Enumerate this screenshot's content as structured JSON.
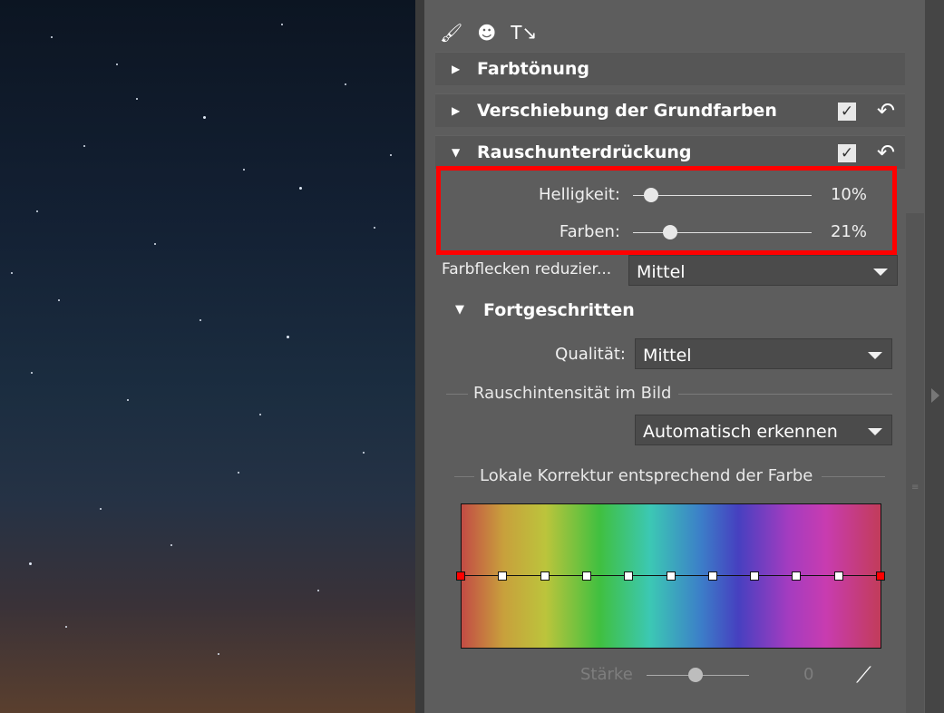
{
  "toolbar": {
    "icons": [
      "brush-icon",
      "mask-icon",
      "text-icon"
    ],
    "glyphs": {
      "brush": "🖌",
      "mask": "☻",
      "text": "T↘"
    }
  },
  "sections": {
    "farbtoenung": {
      "label": "Farbtönung",
      "expanded": false
    },
    "verschiebung": {
      "label": "Verschiebung der Grundfarben",
      "expanded": false,
      "checked": true
    },
    "rausch": {
      "label": "Rauschunterdrückung",
      "expanded": true,
      "checked": true
    }
  },
  "glyphs": {
    "collapsed": "▶",
    "expanded": "▼",
    "check": "✓",
    "undo": "↶",
    "picker": "⟋",
    "grip": "≡"
  },
  "noise": {
    "helligkeit": {
      "label": "Helligkeit:",
      "value": 10,
      "display": "10%"
    },
    "farben": {
      "label": "Farben:",
      "value": 21,
      "display": "21%"
    }
  },
  "farbflecken": {
    "label": "Farbflecken reduzier...",
    "value": "Mittel"
  },
  "fortgeschritten": {
    "label": "Fortgeschritten",
    "qualitaet": {
      "label": "Qualität:",
      "value": "Mittel"
    },
    "rauschintensitaet": {
      "label": "Rauschintensität im Bild",
      "value": "Automatisch erkennen"
    },
    "lokale": {
      "label": "Lokale Korrektur entsprechend der Farbe"
    },
    "staerke": {
      "label": "Stärke",
      "value": "0"
    }
  },
  "colors": {
    "highlight": "#ff0000",
    "panel": "#5d5d5d"
  }
}
